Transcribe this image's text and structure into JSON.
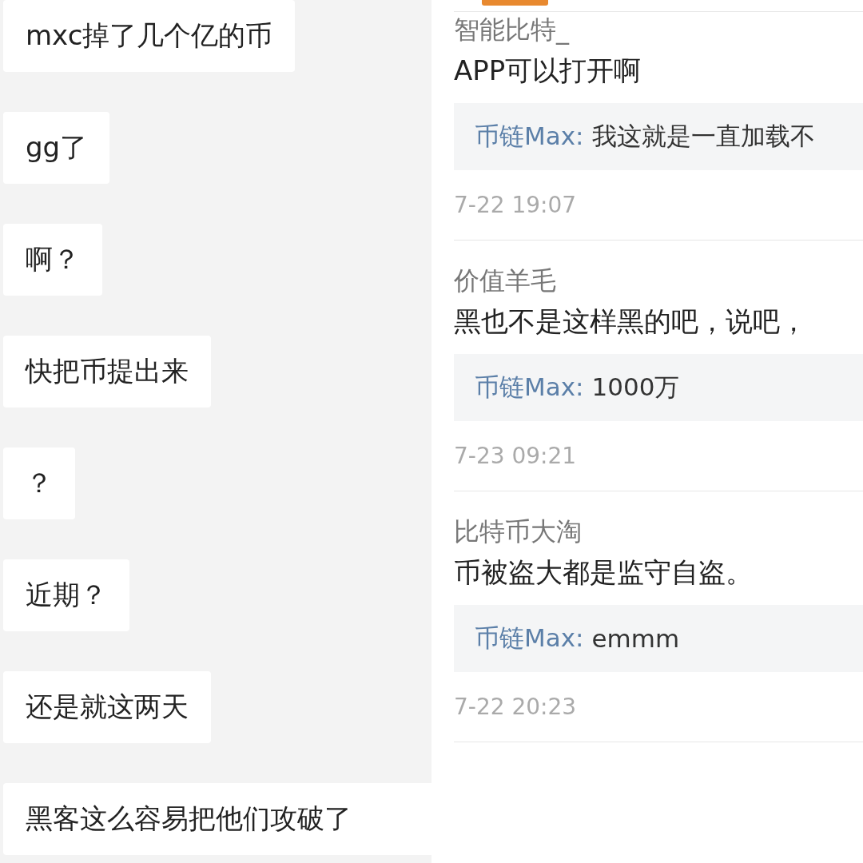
{
  "chat": {
    "messages": [
      {
        "text": "mxc掉了几个亿的币"
      },
      {
        "text": "gg了"
      },
      {
        "text": "啊？"
      },
      {
        "text": "快把币提出来"
      },
      {
        "text": "？"
      },
      {
        "text": "近期？"
      },
      {
        "text": "还是就这两天"
      },
      {
        "text": "黑客这么容易把他们攻破了"
      }
    ]
  },
  "comments": [
    {
      "author": "智能比特_",
      "text": "APP可以打开啊",
      "reply": {
        "author": "币链Max:",
        "text": "我这就是一直加载不"
      },
      "time": "7-22 19:07"
    },
    {
      "author": "价值羊毛",
      "text": "黑也不是这样黑的吧，说吧，",
      "reply": {
        "author": "币链Max:",
        "text": "1000万"
      },
      "time": "7-23 09:21"
    },
    {
      "author": "比特币大淘",
      "text": "币被盗大都是监守自盗。",
      "reply": {
        "author": "币链Max:",
        "text": "emmm"
      },
      "time": "7-22 20:23"
    }
  ]
}
